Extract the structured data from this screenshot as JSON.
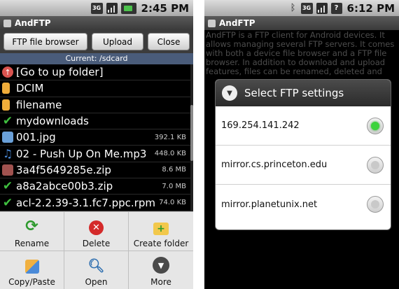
{
  "left": {
    "status": {
      "clock": "2:45 PM",
      "network": "3G"
    },
    "app_title": "AndFTP",
    "buttons": [
      "FTP file browser",
      "Upload",
      "Close"
    ],
    "current_path": "Current: /sdcard",
    "files": [
      {
        "name": "[Go to up folder]",
        "size": "",
        "icon": "up-folder-icon"
      },
      {
        "name": "DCIM",
        "size": "",
        "icon": "folder-icon"
      },
      {
        "name": "filename",
        "size": "",
        "icon": "folder-icon"
      },
      {
        "name": "mydownloads",
        "size": "",
        "icon": "checkmark-icon"
      },
      {
        "name": "001.jpg",
        "size": "392.1 KB",
        "icon": "image-icon"
      },
      {
        "name": "02 - Push Up On Me.mp3",
        "size": "448.0 KB",
        "icon": "music-icon"
      },
      {
        "name": "3a4f5649285e.zip",
        "size": "8.6 MB",
        "icon": "zip-icon"
      },
      {
        "name": "a8a2abce00b3.zip",
        "size": "7.0 MB",
        "icon": "checkmark-icon"
      },
      {
        "name": "acl-2.2.39-3.1.fc7.ppc.rpm",
        "size": "74.0 KB",
        "icon": "checkmark-icon"
      }
    ],
    "menu": [
      "Rename",
      "Delete",
      "Create folder",
      "Copy/Paste",
      "Open",
      "More"
    ]
  },
  "right": {
    "status": {
      "clock": "6:12 PM",
      "network": "3G"
    },
    "app_title": "AndFTP",
    "background_text": [
      "AndFTP is a FTP client for Android devices. It",
      "allows managing several FTP servers. It comes",
      "with both a device file browser and a FTP file",
      "browser. In addition to download and upload",
      "features, files can be renamed, deleted and"
    ],
    "dialog": {
      "title": "Select FTP settings",
      "options": [
        {
          "label": "169.254.141.242",
          "selected": true
        },
        {
          "label": "mirror.cs.princeton.edu",
          "selected": false
        },
        {
          "label": "mirror.planetunix.net",
          "selected": false
        }
      ]
    }
  },
  "colors": {
    "accent_green": "#3cd33c",
    "path_bar": "#4a5c7a"
  }
}
